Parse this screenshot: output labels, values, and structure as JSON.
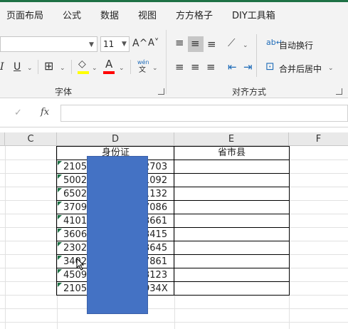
{
  "tabs": [
    "页面布局",
    "公式",
    "数据",
    "视图",
    "方方格子",
    "DIY工具箱"
  ],
  "ribbon": {
    "font_size": "11",
    "grow_font": "A^",
    "shrink_font": "A˅",
    "italic": "I",
    "underline": "U",
    "font_color_letter": "A",
    "wen_top": "wén",
    "wen_bottom": "文",
    "font_group_label": "字体",
    "wrap_text": "自动换行",
    "merge_center": "合并后居中",
    "align_group_label": "对齐方式",
    "colors": {
      "fill_bar": "#ffff00",
      "font_bar": "#ff0000"
    }
  },
  "formula_bar": {
    "cancel": "✓",
    "fx": "fx",
    "value": ""
  },
  "columns": [
    "C",
    "D",
    "E",
    "F"
  ],
  "table": {
    "header_d": "身份证",
    "header_e": "省市县",
    "rows": [
      {
        "left": "2105",
        "right": "2703"
      },
      {
        "left": "5002",
        "right": "1092"
      },
      {
        "left": "6502",
        "right": "1132"
      },
      {
        "left": "3709",
        "right": "7086"
      },
      {
        "left": "4101",
        "right": "3661"
      },
      {
        "left": "3606",
        "right": "3415"
      },
      {
        "left": "2302",
        "right": "3645"
      },
      {
        "left": "3402",
        "right": "7861"
      },
      {
        "left": "4509",
        "right": "3123"
      },
      {
        "left": "2105",
        "right": "934X"
      }
    ]
  },
  "redaction_color": "#4472c4"
}
